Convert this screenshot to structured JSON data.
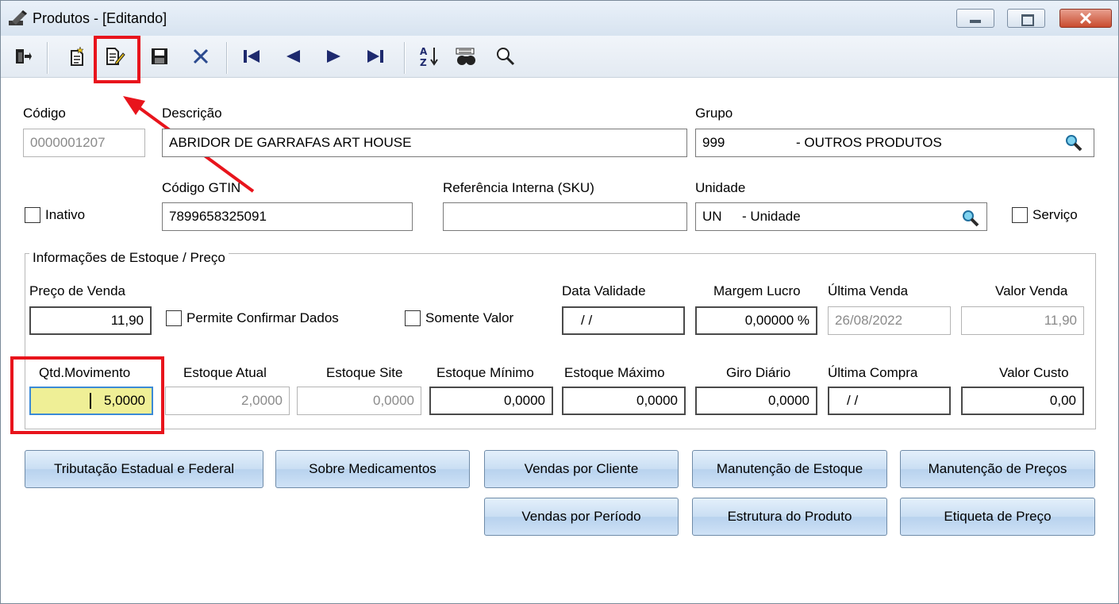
{
  "window": {
    "title": "Produtos - [Editando]"
  },
  "toolbar": {
    "items": [
      "exit-icon",
      "new-record-icon",
      "edit-record-icon",
      "save-icon",
      "cancel-icon",
      "first-record-icon",
      "prev-record-icon",
      "next-record-icon",
      "last-record-icon",
      "sort-az-icon",
      "find-binoculars-icon",
      "search-icon"
    ]
  },
  "form": {
    "codigo_label": "Código",
    "codigo_value": "0000001207",
    "descricao_label": "Descrição",
    "descricao_value": "ABRIDOR DE GARRAFAS ART HOUSE",
    "grupo_label": "Grupo",
    "grupo_code": "999",
    "grupo_name": "- OUTROS PRODUTOS",
    "inativo_label": "Inativo",
    "gtin_label": "Código GTIN",
    "gtin_value": "7899658325091",
    "sku_label": "Referência Interna (SKU)",
    "sku_value": "",
    "unidade_label": "Unidade",
    "unidade_code": "UN",
    "unidade_name": "- Unidade",
    "servico_label": "Serviço"
  },
  "stock": {
    "group_title": "Informações de Estoque / Preço",
    "preco_venda_label": "Preço de Venda",
    "preco_venda_value": "11,90",
    "permite_label": "Permite Confirmar Dados",
    "somente_label": "Somente Valor",
    "data_validade_label": "Data Validade",
    "data_validade_value": "/ /",
    "margem_label": "Margem Lucro",
    "margem_value": "0,00000 %",
    "ultima_venda_label": "Última Venda",
    "ultima_venda_value": "26/08/2022",
    "valor_venda_label": "Valor Venda",
    "valor_venda_value": "11,90",
    "qtd_mov_label": "Qtd.Movimento",
    "qtd_mov_value": "5,0000",
    "estoque_atual_label": "Estoque Atual",
    "estoque_atual_value": "2,0000",
    "estoque_site_label": "Estoque Site",
    "estoque_site_value": "0,0000",
    "estoque_min_label": "Estoque Mínimo",
    "estoque_min_value": "0,0000",
    "estoque_max_label": "Estoque Máximo",
    "estoque_max_value": "0,0000",
    "giro_label": "Giro Diário",
    "giro_value": "0,0000",
    "ultima_compra_label": "Última Compra",
    "ultima_compra_value": "/ /",
    "valor_custo_label": "Valor Custo",
    "valor_custo_value": "0,00"
  },
  "buttons": {
    "tributacao": "Tributação Estadual e Federal",
    "medicamentos": "Sobre Medicamentos",
    "vendas_cliente": "Vendas por Cliente",
    "manut_estoque": "Manutenção de Estoque",
    "manut_precos": "Manutenção de Preços",
    "vendas_periodo": "Vendas por Período",
    "estrutura": "Estrutura do Produto",
    "etiqueta": "Etiqueta de Preço"
  },
  "colors": {
    "highlight": "#e8141c",
    "qtd_field_bg": "#efef96",
    "button_blue": "#c9def3"
  }
}
